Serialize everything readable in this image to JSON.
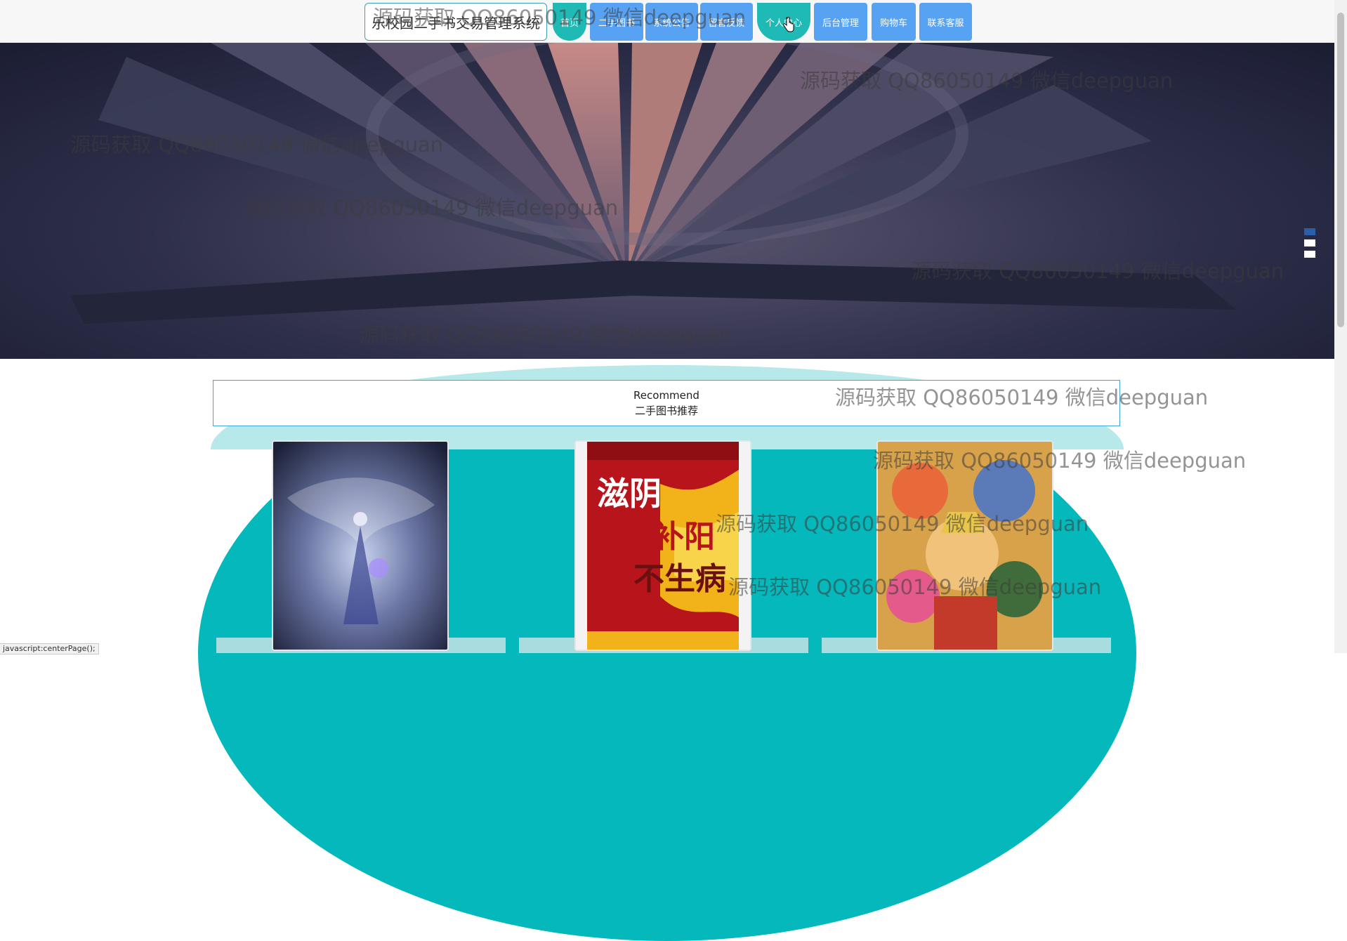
{
  "nav": {
    "brand": "乐校园二手书交易管理系统",
    "items": [
      {
        "label": "首页"
      },
      {
        "label": "二手图书"
      },
      {
        "label": "系统公告"
      },
      {
        "label": "留言反馈"
      },
      {
        "label": "个人中心"
      },
      {
        "label": "后台管理"
      },
      {
        "label": "购物车"
      },
      {
        "label": "联系客服"
      }
    ],
    "active": "个人中心"
  },
  "recommend": {
    "title_en": "Recommend",
    "title_zh": "二手图书推荐"
  },
  "watermark": "源码获取 QQ86050149 微信deepguan",
  "status_text": "javascript:centerPage();",
  "colors": {
    "nav_blue": "#57a2f2",
    "nav_teal": "#1fbab5",
    "section_teal": "#05b8bb"
  }
}
